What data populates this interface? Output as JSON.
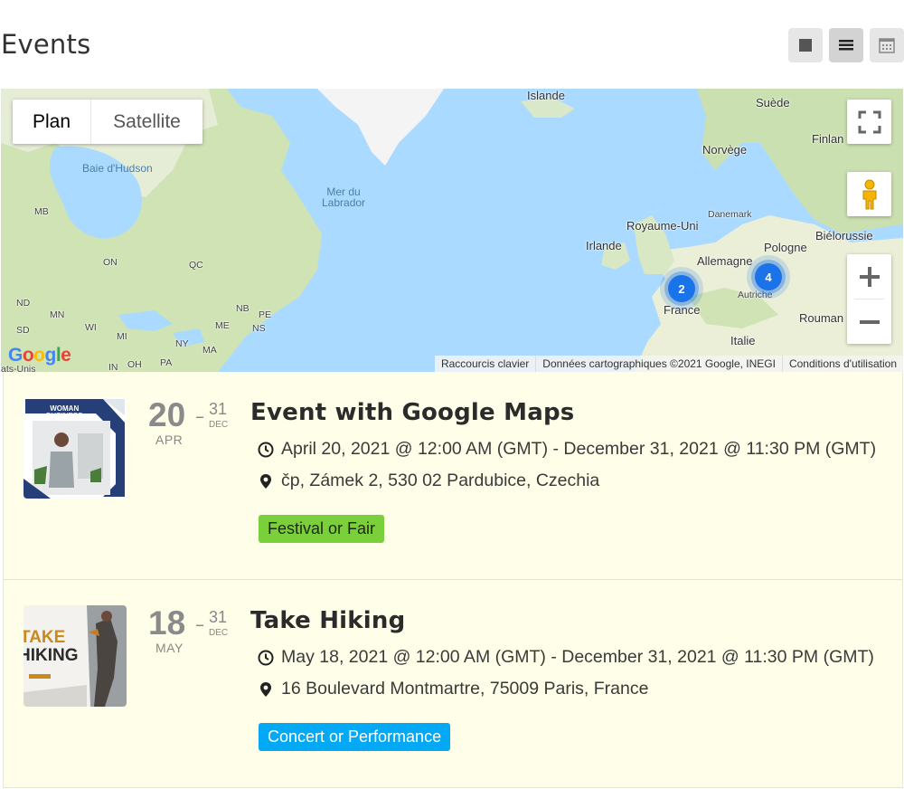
{
  "page": {
    "title": "Events"
  },
  "view_switcher": [
    {
      "name": "grid-view-button",
      "icon": "square-icon",
      "active": false
    },
    {
      "name": "list-view-button",
      "icon": "list-icon",
      "active": true
    },
    {
      "name": "calendar-view-button",
      "icon": "calendar-icon",
      "active": false
    }
  ],
  "map": {
    "type_buttons": {
      "plan": "Plan",
      "satellite": "Satellite"
    },
    "labels": {
      "islande": "Islande",
      "suede": "Suède",
      "finland": "Finlan",
      "norvege": "Norvège",
      "baie": "Baie d'Hudson",
      "mer": "Mer du\nLabrador",
      "danemark": "Danemark",
      "royaume": "Royaume-Uni",
      "irlande": "Irlande",
      "pologne": "Pologne",
      "bielorussie": "Biélorussie",
      "allemagne": "Allemagne",
      "autriche": "Autriche",
      "france": "France",
      "roumanie": "Rouman",
      "italie": "Italie",
      "mb": "MB",
      "on": "ON",
      "qc": "QC",
      "nb": "NB",
      "pe": "PE",
      "ns": "NS",
      "me": "ME",
      "nd": "ND",
      "mn": "MN",
      "sd": "SD",
      "wi": "WI",
      "mi": "MI",
      "ny": "NY",
      "ma": "MA",
      "pa": "PA",
      "oh": "OH",
      "in": "IN",
      "etats": "ats-Unis"
    },
    "clusters": [
      {
        "count": "2"
      },
      {
        "count": "4"
      }
    ],
    "logo": {
      "g1": "G",
      "o1": "o",
      "o2": "o",
      "g2": "g",
      "l": "l",
      "e": "e"
    },
    "attribution": {
      "shortcuts": "Raccourcis clavier",
      "data": "Données cartographiques ©2021 Google, INEGI",
      "terms": "Conditions d'utilisation"
    }
  },
  "events": [
    {
      "day": "20",
      "month": "APR",
      "end_day": "31",
      "end_month": "DEC",
      "title": "Event with Google Maps",
      "datetime": "April 20, 2021 @ 12:00 AM (GMT) - December 31, 2021 @ 11:30 PM (GMT)",
      "location": "čp, Zámek 2, 530 02 Pardubice, Czechia",
      "category": "Festival or Fair",
      "category_color": "#7ad03a",
      "thumb_text": [
        "WOMAN",
        "BUSINESS"
      ]
    },
    {
      "day": "18",
      "month": "MAY",
      "end_day": "31",
      "end_month": "DEC",
      "title": "Take Hiking",
      "datetime": "May 18, 2021 @ 12:00 AM (GMT) - December 31, 2021 @ 11:30 PM (GMT)",
      "location": "16 Boulevard Montmartre, 75009 Paris, France",
      "category": "Concert or Performance",
      "category_color": "#03a9f4",
      "thumb_text": [
        "TAKE",
        "HIKING"
      ]
    }
  ]
}
